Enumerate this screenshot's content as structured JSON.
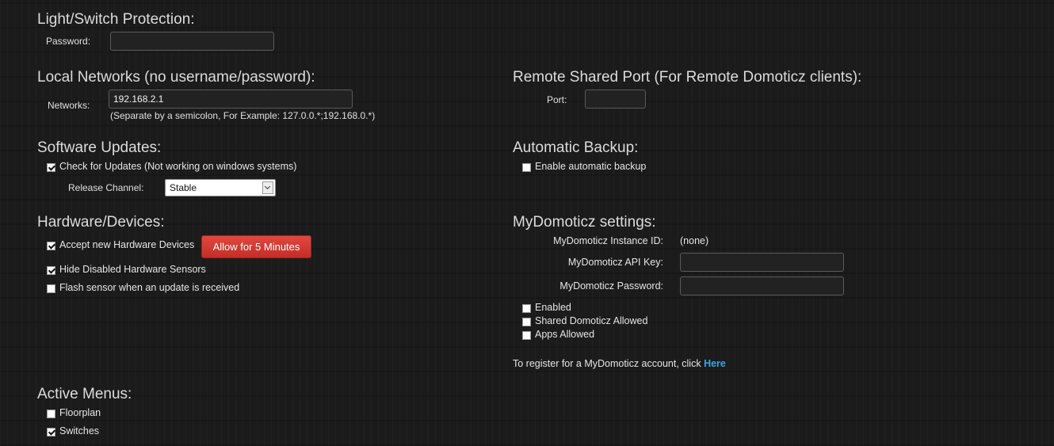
{
  "light_switch": {
    "heading": "Light/Switch Protection:",
    "password_label": "Password:",
    "password_value": ""
  },
  "local_networks": {
    "heading": "Local Networks (no username/password):",
    "networks_label": "Networks:",
    "networks_value": "192.168.2.1",
    "hint": "(Separate by a semicolon, For Example: 127.0.0.*;192.168.0.*)"
  },
  "remote_port": {
    "heading": "Remote Shared Port (For Remote Domoticz clients):",
    "port_label": "Port:",
    "port_value": ""
  },
  "software_updates": {
    "heading": "Software Updates:",
    "check_label": "Check for Updates (Not working on windows systems)",
    "check_checked": true,
    "channel_label": "Release Channel:",
    "channel_value": "Stable"
  },
  "automatic_backup": {
    "heading": "Automatic Backup:",
    "enable_label": "Enable automatic backup",
    "enable_checked": false
  },
  "hardware": {
    "heading": "Hardware/Devices:",
    "accept_label": "Accept new Hardware Devices",
    "accept_checked": true,
    "allow_button": "Allow for 5 Minutes",
    "hide_label": "Hide Disabled Hardware Sensors",
    "hide_checked": true,
    "flash_label": "Flash sensor when an update is received",
    "flash_checked": false
  },
  "mydomoticz": {
    "heading": "MyDomoticz settings:",
    "instance_label": "MyDomoticz Instance ID:",
    "instance_value": "(none)",
    "apikey_label": "MyDomoticz API Key:",
    "apikey_value": "",
    "password_label": "MyDomoticz Password:",
    "password_value": "",
    "enabled_label": "Enabled",
    "shared_label": "Shared Domoticz Allowed",
    "apps_label": "Apps Allowed",
    "register_text": "To register for a MyDomoticz account, click",
    "register_link": "Here"
  },
  "active_menus": {
    "heading": "Active Menus:",
    "floorplan_label": "Floorplan",
    "floorplan_checked": false,
    "switches_label": "Switches",
    "switches_checked": true
  },
  "colors": {
    "button_red": "#d33a32",
    "link_blue": "#3aa6e0"
  }
}
